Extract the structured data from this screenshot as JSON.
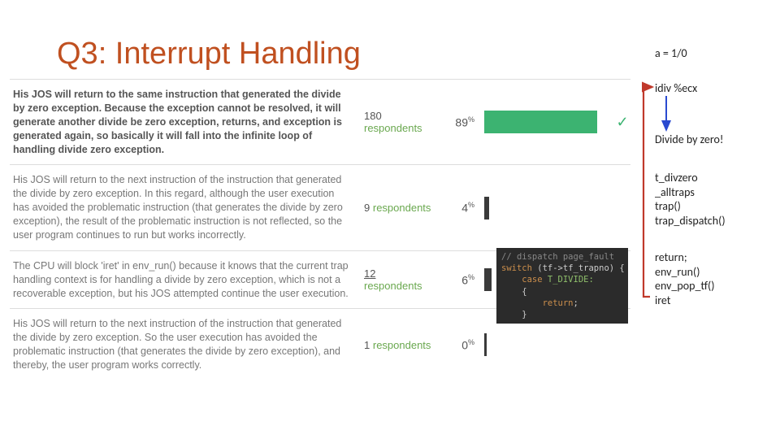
{
  "title": "Q3: Interrupt Handling",
  "poll": {
    "rows": [
      {
        "text_bold": "His JOS will return to the same instruction that generated the divide by zero exception. Because the exception cannot be resolved, it will generate another divide be zero exception, returns, and exception is generated again, so basically it will fall into the infinite loop of handling divide zero exception.",
        "text_rest": "",
        "respondents_num": "180",
        "respondents_label": "respondents",
        "pct": "89",
        "bar_pct": 89,
        "green": true,
        "correct": true
      },
      {
        "text_bold": "",
        "text_rest": "His JOS will return to the next instruction of the instruction that generated the divide by zero exception. In this regard, although the user execution has avoided the problematic instruction (that generates the divide by zero exception), the result of the problematic instruction is not reflected, so the user program continues to run but works incorrectly.",
        "respondents_num": "9",
        "respondents_label": "respondents",
        "pct": "4",
        "bar_pct": 4,
        "green": false,
        "correct": false
      },
      {
        "text_bold": "",
        "text_rest": "The CPU will block 'iret' in env_run() because it knows that the current trap handling context is for handling a divide by zero exception, which is not a recoverable exception, but his JOS attempted continue the user execution.",
        "respondents_num": "12",
        "respondents_label": "respondents",
        "respondents_underline": true,
        "pct": "6",
        "bar_pct": 6,
        "green": false,
        "correct": false
      },
      {
        "text_bold": "",
        "text_rest": "His JOS will return to the next instruction of the instruction that generated the divide by zero exception. So the user execution has avoided the problematic instruction (that generates the divide by zero exception), and thereby, the user program works correctly.",
        "respondents_num": "1",
        "respondents_label": "respondents",
        "pct": "0",
        "bar_pct": 1,
        "green": false,
        "correct": false
      }
    ]
  },
  "code_snippet": {
    "l1": "// dispatch page_fault",
    "l2a": "switch",
    "l2b": " (tf->tf_trapno) {",
    "l3a": "    case",
    "l3b": " T_DIVIDE:",
    "l4": "    {",
    "l5a": "        return",
    "l5b": ";",
    "l6": "    }"
  },
  "right": {
    "a": "a = 1/0",
    "idiv": "idiv %ecx",
    "dvz": "Divide by zero!",
    "stack": "t_divzero\n_alltraps\ntrap()\ntrap_dispatch()",
    "ret": "return;\nenv_run()\nenv_pop_tf()\niret"
  }
}
